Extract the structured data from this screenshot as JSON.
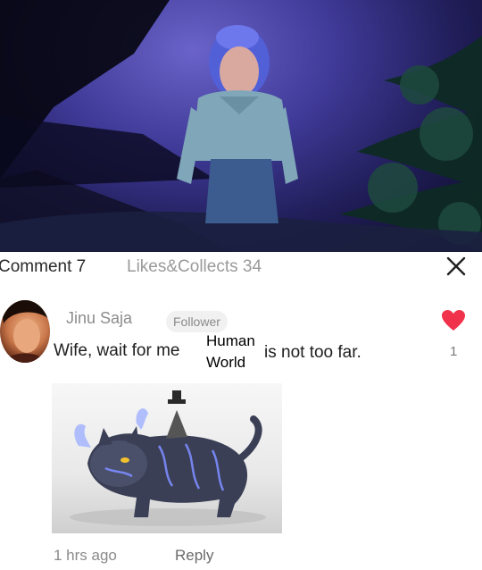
{
  "header": {
    "comment_tab": "Comment 7",
    "likes_tab": "Likes&Collects 34"
  },
  "comment": {
    "username": "Jinu Saja",
    "badge": "Follower",
    "text_part1": "Wife,  wait for me",
    "text_part2a": "Human",
    "text_part2b": "World",
    "text_part3": "is not too far.",
    "like_count": "1",
    "time": "1 hrs ago",
    "reply_label": "Reply"
  },
  "icons": {
    "close": "close-icon",
    "heart": "heart-icon"
  },
  "colors": {
    "heart": "#f0324b",
    "text_primary": "#1e1e1e",
    "text_secondary": "#8c8c8c"
  }
}
